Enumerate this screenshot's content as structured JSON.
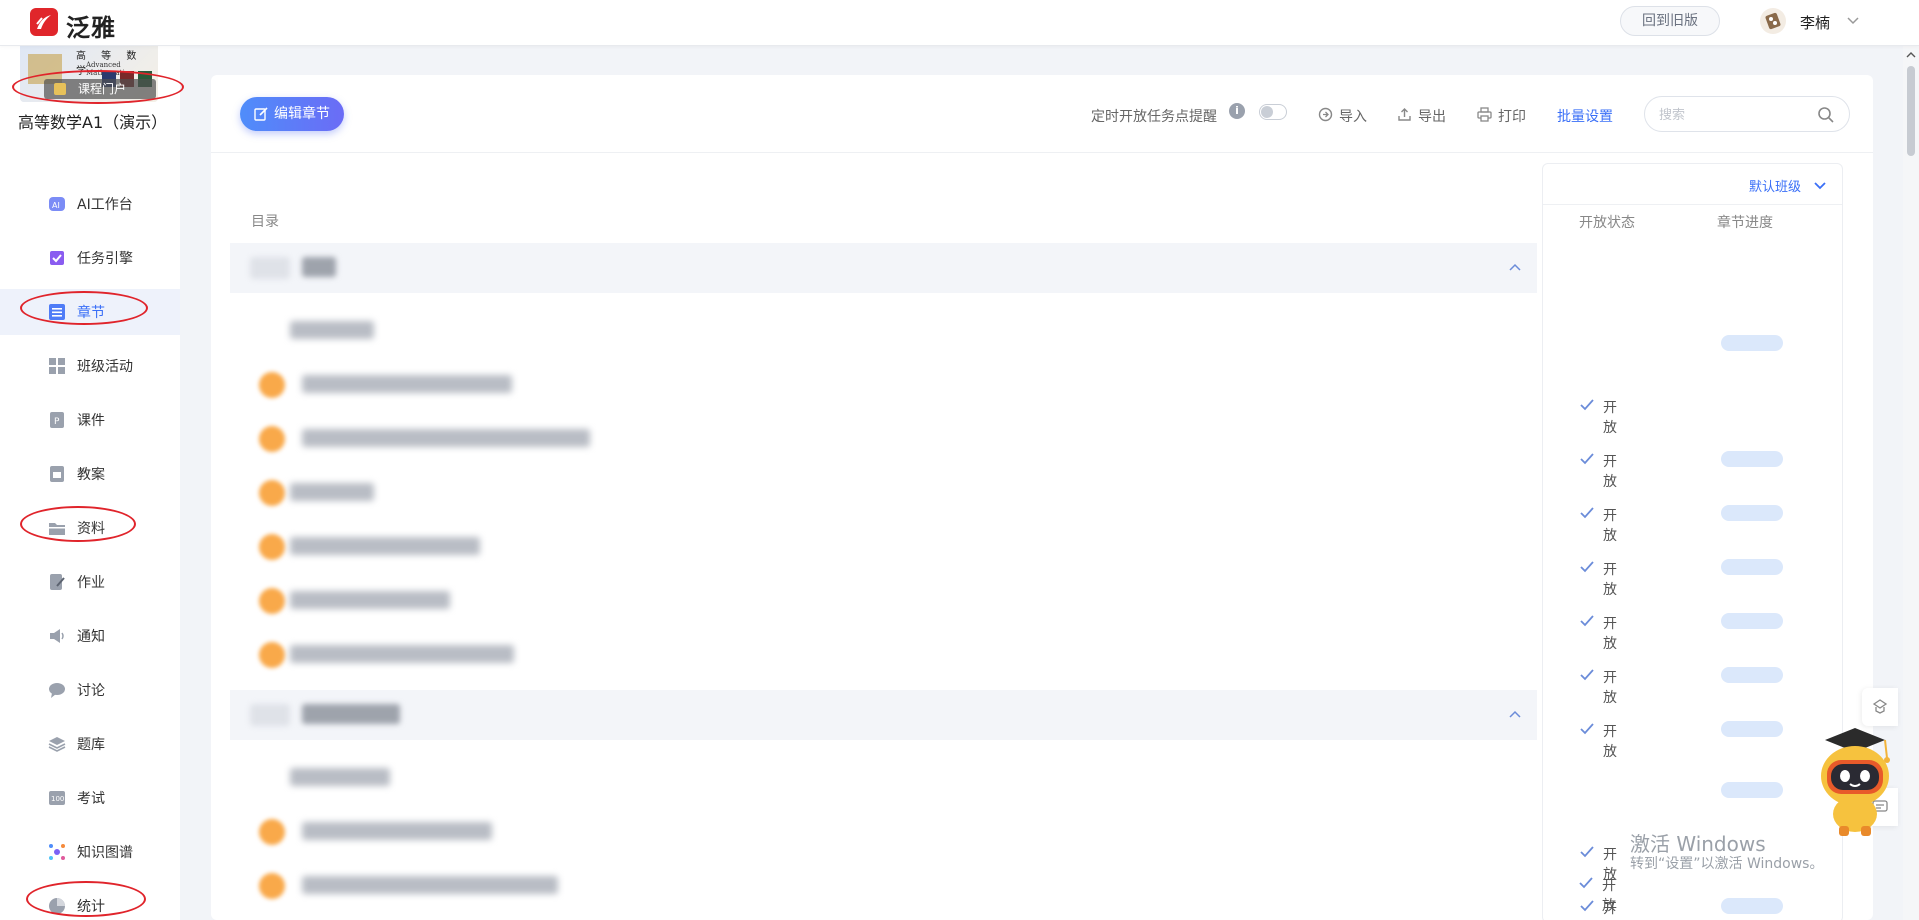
{
  "app": {
    "brand": "泛雅",
    "old_version": "回到旧版",
    "user_name": "李楠"
  },
  "course": {
    "title": "高等数学A1（演示）",
    "portal_button": "课程门户",
    "thumb_title": "高 等 数 学",
    "thumb_subtitle": "Advanced Mathematics"
  },
  "sidebar": {
    "items": [
      {
        "label": "AI工作台",
        "icon": "ai-workbench-icon"
      },
      {
        "label": "任务引擎",
        "icon": "task-engine-icon"
      },
      {
        "label": "章节",
        "icon": "chapter-list-icon",
        "active": true
      },
      {
        "label": "班级活动",
        "icon": "class-activity-icon"
      },
      {
        "label": "课件",
        "icon": "courseware-icon"
      },
      {
        "label": "教案",
        "icon": "lesson-plan-icon"
      },
      {
        "label": "资料",
        "icon": "materials-folder-icon"
      },
      {
        "label": "作业",
        "icon": "homework-icon"
      },
      {
        "label": "通知",
        "icon": "notice-speaker-icon"
      },
      {
        "label": "讨论",
        "icon": "discussion-bubble-icon"
      },
      {
        "label": "题库",
        "icon": "question-bank-icon"
      },
      {
        "label": "考试",
        "icon": "exam-icon"
      },
      {
        "label": "知识图谱",
        "icon": "knowledge-graph-icon"
      },
      {
        "label": "统计",
        "icon": "statistics-pie-icon"
      }
    ]
  },
  "toolbar": {
    "edit_chapter": "编辑章节",
    "timed_reminder": "定时开放任务点提醒",
    "timed_reminder_on": false,
    "import": "导入",
    "export": "导出",
    "print": "打印",
    "batch_settings": "批量设置",
    "search_placeholder": "搜索"
  },
  "catalog": {
    "header": "目录"
  },
  "right_panel": {
    "class_selector": "默认班级",
    "col_status": "开放状态",
    "col_progress": "章节进度",
    "open_label": "开放"
  },
  "rows": [
    {
      "type": "chapter"
    },
    {
      "type": "section",
      "status": "开放",
      "has_dot": false
    },
    {
      "type": "section",
      "status": "开放",
      "has_dot": true
    },
    {
      "type": "section",
      "status": "开放",
      "has_dot": true
    },
    {
      "type": "section",
      "status": "开放",
      "has_dot": true
    },
    {
      "type": "section",
      "status": "开放",
      "has_dot": true
    },
    {
      "type": "section",
      "status": "开放",
      "has_dot": true
    },
    {
      "type": "section",
      "status": "开放",
      "has_dot": true
    },
    {
      "type": "chapter"
    },
    {
      "type": "section",
      "status": "开放",
      "has_dot": false
    },
    {
      "type": "section",
      "status": "开放",
      "has_dot": true
    },
    {
      "type": "section",
      "status": "开放",
      "has_dot": true
    }
  ],
  "watermark": {
    "line1": "激活 Windows",
    "line2": "转到“设置”以激活 Windows。"
  },
  "colors": {
    "accent": "#3a6ff7",
    "brand_red": "#e0262b",
    "highlight_circle": "#e0242b",
    "dot_orange": "#f9a94a"
  }
}
